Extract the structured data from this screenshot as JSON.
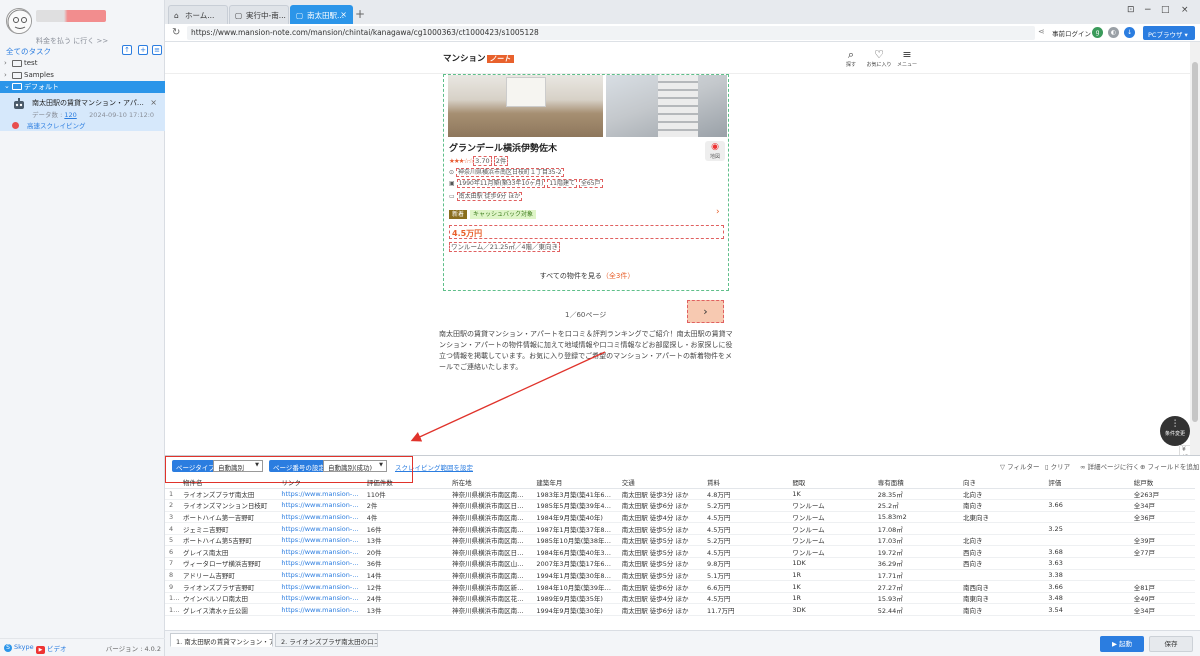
{
  "sidebar": {
    "pricing_link": "料金を払う に行く >>",
    "all_tasks": "全てのタスク",
    "folders": [
      {
        "label": "test",
        "expanded": false
      },
      {
        "label": "Samples",
        "expanded": false
      },
      {
        "label": "デフォルト",
        "expanded": true
      }
    ],
    "task": {
      "title": "南太田駅の賃貸マンション・アパート | 評...",
      "count_label": "データ数 :",
      "count": "120",
      "datetime": "2024-09-10 17:12:0",
      "mode": "高速スクレイピング"
    },
    "footer": {
      "skype": "Skype",
      "video": "ビデオ",
      "version": "バージョン : 4.0.2"
    }
  },
  "tabs": [
    {
      "label": "ホーム...",
      "active": false
    },
    {
      "label": "実行中-南...",
      "active": false
    },
    {
      "label": "南太田駅...",
      "active": true
    }
  ],
  "address": {
    "url": "https://www.mansion-note.com/mansion/chintai/kanagawa/cg1000363/ct1000423/s1005128",
    "pre_login": "事前ログイン",
    "browser_mode": "PCブラウザ"
  },
  "site": {
    "logo_main": "マンション",
    "logo_note": "ノート",
    "nav": [
      {
        "icon": "search-icon",
        "label": "探す"
      },
      {
        "icon": "heart-icon",
        "label": "お気に入り"
      },
      {
        "icon": "menu-icon",
        "label": "メニュー"
      }
    ],
    "listing": {
      "name": "グランデール横浜伊勢佐木",
      "stars": "★★★☆☆",
      "score": "3.70",
      "reviews": "2件",
      "map_label": "地図",
      "address": "神奈川県横浜市南区日枝町１丁目35-2",
      "built": "1990年11月築(築33年10ヶ月)",
      "floors": "11階建て",
      "units": "全65戸",
      "access": "南太田駅 徒歩9分 ほか",
      "tag_new": "新着",
      "tag_cashback": "キャッシュバック対象",
      "price": "4.5万円",
      "specs": "ワンルーム／21.25㎡／4階／東向き",
      "see_all_prefix": "すべての物件を見る",
      "see_all_count": "（全3件）"
    },
    "pager": "1／60ページ",
    "next_label": "›",
    "description": "南太田駅の賃貸マンション・アパートを口コミ＆評判ランキングでご紹介！南太田駅の賃貸マンション・アパートの物件情報に加えて地域情報や口コミ情報などお部屋探し・お家探しに役立つ情報を掲載しています。お気に入り登録でご希望のマンション・アパートの新着物件をメールでご連絡いたします。",
    "filter_fab": "条件変更",
    "collapse": "折る"
  },
  "datapanel": {
    "page_type_label": "ページタイプ",
    "page_type_value": "自動識別",
    "page_num_label": "ページ番号の設定",
    "page_num_value": "自動識別(成功)",
    "scrape_range": "スクレイピング範囲を設定",
    "actions": {
      "filter": "フィルター",
      "clear": "クリア",
      "detail": "詳細ページに行く",
      "add_field": "フィールドを追加"
    },
    "columns": [
      "物件名",
      "リンク",
      "評価件数",
      "所在地",
      "建築年月",
      "交通",
      "賃料",
      "間取",
      "専有面積",
      "向き",
      "評価",
      "総戸数"
    ],
    "rows": [
      [
        "1",
        "ライオンズプラザ南太田",
        "https://www.mansion-note.com...",
        "110件",
        "神奈川県横浜市南区南太田一...",
        "1983年3月築(築41年6ヶ月)",
        "南太田駅 徒歩3分 ほか",
        "4.8万円",
        "1K",
        "28.35㎡",
        "北向き",
        "",
        "全263戸"
      ],
      [
        "2",
        "ライオンズマンション日枝町",
        "https://www.mansion-note.com...",
        "2件",
        "神奈川県横浜市南区日枝町５...",
        "1985年5月築(築39年4ヶ月)",
        "南太田駅 徒歩6分 ほか",
        "5.2万円",
        "ワンルーム",
        "25.2㎡",
        "南向き",
        "3.66",
        "全34戸"
      ],
      [
        "3",
        "ボートハイム第一吉野町",
        "https://www.mansion-note.com...",
        "4件",
        "神奈川県横浜市南区南吉田町...",
        "1984年9月築(築40年)",
        "南太田駅 徒歩4分 ほか",
        "4.5万円",
        "ワンルーム",
        "15.83m2",
        "北東向き",
        "",
        "全36戸"
      ],
      [
        "4",
        "ジェミニ吉野町",
        "https://www.mansion-note.com...",
        "16件",
        "神奈川県横浜市南区南吉田町...",
        "1987年1月築(築37年8ヶ月)",
        "南太田駅 徒歩5分 ほか",
        "4.5万円",
        "ワンルーム",
        "17.08㎡",
        "",
        "3.25",
        ""
      ],
      [
        "5",
        "ボートハイム第5吉野町",
        "https://www.mansion-note.com...",
        "13件",
        "神奈川県横浜市南区南吉田町...",
        "1985年10月築(築38年11ヶ月)",
        "南太田駅 徒歩5分 ほか",
        "5.2万円",
        "ワンルーム",
        "17.03㎡",
        "北向き",
        "",
        "全39戸"
      ],
      [
        "6",
        "グレイス南太田",
        "https://www.mansion-note.com...",
        "20件",
        "神奈川県横浜市南区日枝町４...",
        "1984年6月築(築40年3ヶ月)",
        "南太田駅 徒歩5分 ほか",
        "4.5万円",
        "ワンルーム",
        "19.72㎡",
        "西向き",
        "3.68",
        "全77戸"
      ],
      [
        "7",
        "ヴィータローザ横浜吉野町",
        "https://www.mansion-note.com...",
        "36件",
        "神奈川県横浜市南区山王町４...",
        "2007年3月築(築17年6ヶ月)",
        "南太田駅 徒歩5分 ほか",
        "9.8万円",
        "1DK",
        "36.29㎡",
        "西向き",
        "3.63",
        ""
      ],
      [
        "8",
        "アドリーム吉野町",
        "https://www.mansion-note.com...",
        "14件",
        "神奈川県横浜市南区南吉田町...",
        "1994年1月築(築30年8ヶ月)",
        "南太田駅 徒歩5分 ほか",
        "5.1万円",
        "1R",
        "17.71㎡",
        "",
        "3.38",
        ""
      ],
      [
        "9",
        "ライオンズプラザ吉野町",
        "https://www.mansion-note.com...",
        "12件",
        "神奈川県横浜市南区新川町５...",
        "1984年10月築(築39年11ヶ月)",
        "南太田駅 徒歩6分 ほか",
        "6.6万円",
        "1K",
        "27.27㎡",
        "南西向き",
        "3.66",
        "全81戸"
      ],
      [
        "10",
        "ウインベルソロ南太田",
        "https://www.mansion-note.com...",
        "24件",
        "神奈川県横浜市南区花之木町...",
        "1989年9月築(築35年)",
        "南太田駅 徒歩4分 ほか",
        "4.5万円",
        "1R",
        "15.93㎡",
        "南東向き",
        "3.48",
        "全49戸"
      ],
      [
        "11",
        "グレイス清水ヶ丘公園",
        "https://www.mansion-note.com...",
        "13件",
        "神奈川県横浜市南区南太田一...",
        "1994年9月築(築30年)",
        "南太田駅 徒歩6分 ほか",
        "11.7万円",
        "3DK",
        "52.44㎡",
        "南向き",
        "3.54",
        "全34戸"
      ]
    ]
  },
  "bottom": {
    "tabs": [
      "1. 南太田駅の賃貸マンション・ア...",
      "2. ライオンズプラザ南太田の口コ..."
    ],
    "start": "▶  起動",
    "save": "保存"
  },
  "colors": {
    "accent": "#2b7de0",
    "active_folder": "#2b95e9",
    "brand_orange": "#e8612c",
    "annotation_red": "#e0332b"
  }
}
